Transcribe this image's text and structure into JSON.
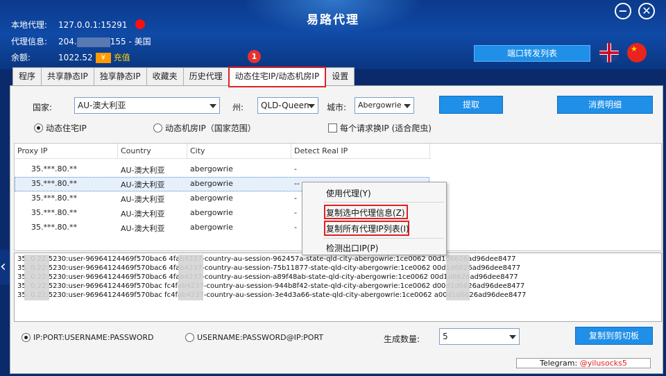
{
  "app": {
    "title": "易路代理"
  },
  "window_buttons": {
    "minimize": "−",
    "close": "✕"
  },
  "info": {
    "local_proxy_label": "本地代理:",
    "local_proxy_value": "127.0.0.1:15291",
    "proxy_info_label": "代理信息:",
    "proxy_info_prefix": "204.",
    "proxy_info_suffix": "155 - 美国",
    "balance_label": "余额:",
    "balance_value": "1022.52",
    "recharge_icon": "¥",
    "recharge_label": "充值"
  },
  "port_forward_button": "端口转发列表",
  "tabs": [
    "程序",
    "共享静态IP",
    "独享静态IP",
    "收藏夹",
    "历史代理",
    "动态住宅IP/动态机房IP",
    "设置"
  ],
  "badges": {
    "one": "1",
    "two": "2"
  },
  "filters": {
    "country_label": "国家:",
    "country_value": "AU-澳大利亚",
    "state_label": "州:",
    "state_value": "QLD-Queen",
    "city_label": "城市:",
    "city_value": "Abergowrie",
    "extract_button": "提取",
    "detail_button": "消费明细",
    "radio_residential": "动态住宅IP",
    "radio_datacenter": "动态机房IP（国家范围）",
    "checkbox_rotate": "每个请求换IP (适合爬虫)"
  },
  "grid": {
    "headers": [
      "Proxy IP",
      "Country",
      "City",
      "Detect Real IP"
    ],
    "rows": [
      [
        "35.***.80.**",
        "AU-澳大利亚",
        "abergowrie",
        "-"
      ],
      [
        "35.***.80.**",
        "AU-澳大利亚",
        "abergowrie",
        "--"
      ],
      [
        "35.***.80.**",
        "AU-澳大利亚",
        "abergowrie",
        "-"
      ],
      [
        "35.***.80.**",
        "AU-澳大利亚",
        "abergowrie",
        "-"
      ],
      [
        "35.***.80.**",
        "AU-澳大利亚",
        "abergowrie",
        "-"
      ]
    ]
  },
  "context_menu": {
    "use_proxy": "使用代理(Y)",
    "copy_selected": "复制选中代理信息(Z)",
    "copy_all": "复制所有代理IP列表(I)",
    "check_exit": "检测出口IP(P)"
  },
  "output_lines": [
    "35.      0.22:5230:user-96964124469f570bac6      4fab4237-country-au-session-962457a-state-qld-city-abergowrie:1ce0062       00d1d6626ad96dee8477",
    "35.      0.22:5230:user-96964124469f570bac6      4fab4237-country-au-session-75b11877-state-qld-city-abergowrie:1ce0062       00d1d6626ad96dee8477",
    "35.      0.22:5230:user-96964124469f570bac6      4fab4237-country-au-session-a89f48ab-state-qld-city-abergowrie:1ce0062       00d1d6626ad96dee8477",
    "35.      0.22:5230:user-96964124469f570bac      fc4fab4237-country-au-session-944b8f42-state-qld-city-abergowrie:1ce0062      d00d1d6626ad96dee8477",
    "35.      0.22:5230:user-96964124469f570bac      fc4fab4237-country-au-session-3e4d3a66-state-qld-city-abergowrie:1ce0062       a00d1d6626ad96dee8477"
  ],
  "format": {
    "option1": "IP:PORT:USERNAME:PASSWORD",
    "option2": "USERNAME:PASSWORD@IP:PORT",
    "count_label": "生成数量:",
    "count_value": "5",
    "copy_button": "复制到剪切板"
  },
  "telegram": {
    "prefix": "Telegram: ",
    "handle": "@yilusocks5"
  },
  "side_arrow": "‹",
  "flags": {
    "cn_star": "★"
  }
}
